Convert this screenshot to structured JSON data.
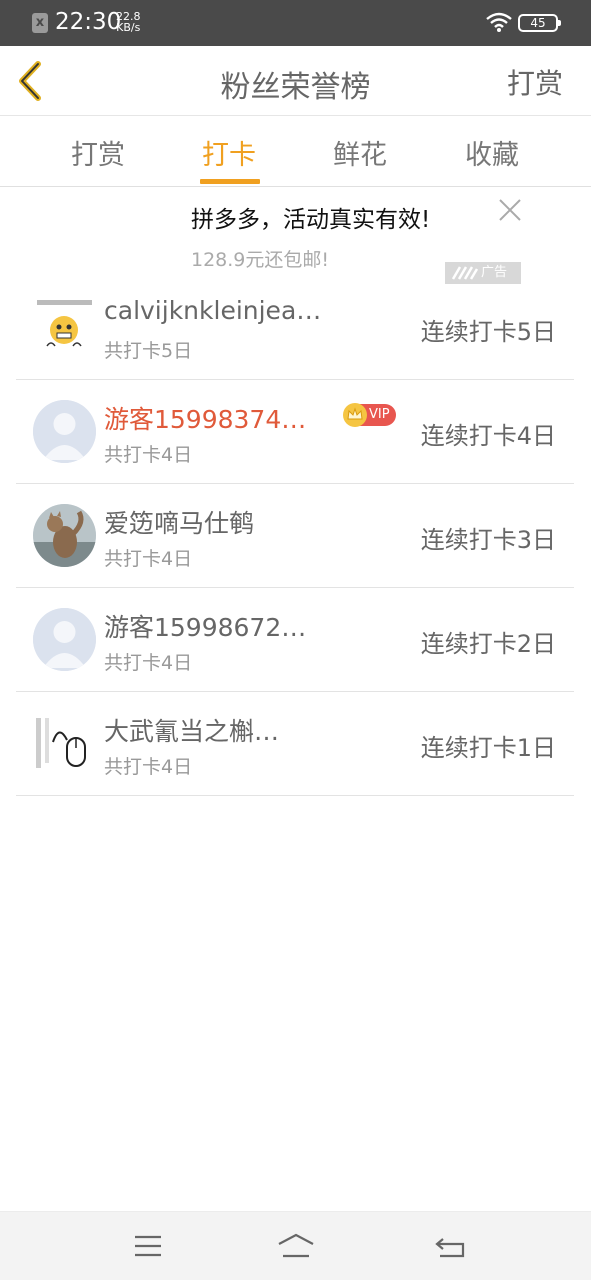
{
  "status_bar": {
    "time": "22:30",
    "net_speed_value": "22.8",
    "net_speed_unit": "KB/s",
    "battery": "45"
  },
  "nav": {
    "title": "粉丝荣誉榜",
    "action": "打赏"
  },
  "tabs": [
    {
      "label": "打赏",
      "active": false
    },
    {
      "label": "打卡",
      "active": true
    },
    {
      "label": "鲜花",
      "active": false
    },
    {
      "label": "收藏",
      "active": false
    }
  ],
  "ad": {
    "title": "拼多多，活动真实有效!",
    "subtitle": "128.9元还包邮!",
    "badge": "广告"
  },
  "list": [
    {
      "name": "calvijknkleinjea…",
      "sub": "共打卡5日",
      "streak": "连续打卡5日",
      "avatar_icon": "emoji-sticker-avatar",
      "vip": false
    },
    {
      "name": "游客15998374…",
      "sub": "共打卡4日",
      "streak": "连续打卡4日",
      "avatar_icon": "default-user-avatar",
      "vip": true,
      "vip_label": "VIP"
    },
    {
      "name": "爱笾嘀马仕鹌",
      "sub": "共打卡4日",
      "streak": "连续打卡3日",
      "avatar_icon": "cat-photo-avatar",
      "vip": false
    },
    {
      "name": "游客15998672…",
      "sub": "共打卡4日",
      "streak": "连续打卡2日",
      "avatar_icon": "default-user-avatar",
      "vip": false
    },
    {
      "name": "大武氰当之槲…",
      "sub": "共打卡4日",
      "streak": "连续打卡1日",
      "avatar_icon": "mouse-sticker-avatar",
      "vip": false
    }
  ],
  "colors": {
    "accent": "#f0a020",
    "vip_name": "#e05a3a",
    "vip_badge": "#e8564f",
    "status_bar": "#4a4a4a"
  }
}
